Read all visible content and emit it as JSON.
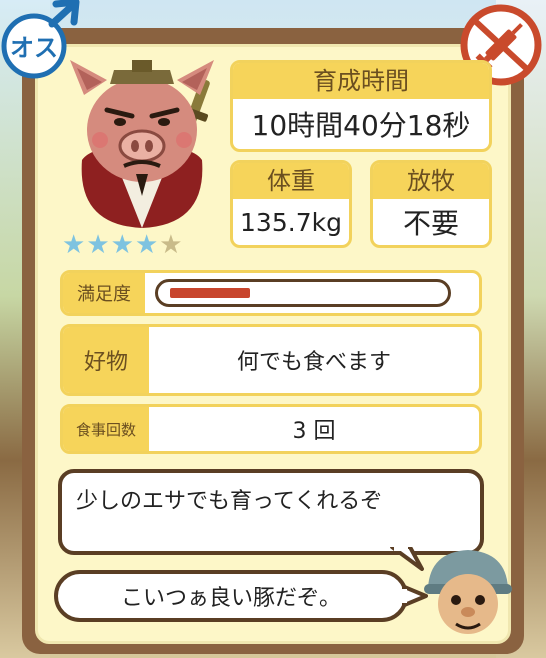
{
  "badges": {
    "sex_label": "オス",
    "sex_icon": "male-symbol-icon",
    "item_icon": "no-syringe-icon",
    "colors": {
      "sex": "#1f6fb2",
      "item": "#c94a2c"
    }
  },
  "pig": {
    "icon": "pig-samurai-icon",
    "rating": 4,
    "max_rating": 5
  },
  "stats": {
    "growth_time_label": "育成時間",
    "growth_time_value": "10時間40分18秒",
    "weight_label": "体重",
    "weight_value": "135.7kg",
    "grazing_label": "放牧",
    "grazing_value": "不要"
  },
  "satisfaction": {
    "label": "満足度",
    "level": 0.3
  },
  "favorite": {
    "label": "好物",
    "value": "何でも食べます"
  },
  "meals": {
    "label": "食事回数",
    "value": "3 回"
  },
  "dialog": {
    "line1": "少しのエサでも育ってくれるぞ",
    "line2": "こいつぁ良い豚だぞ。"
  },
  "colors": {
    "panel": "#8a6240",
    "card_header": "#f6d45a",
    "bar_fill": "#c8452c",
    "star_on": "#7ec3e0"
  }
}
